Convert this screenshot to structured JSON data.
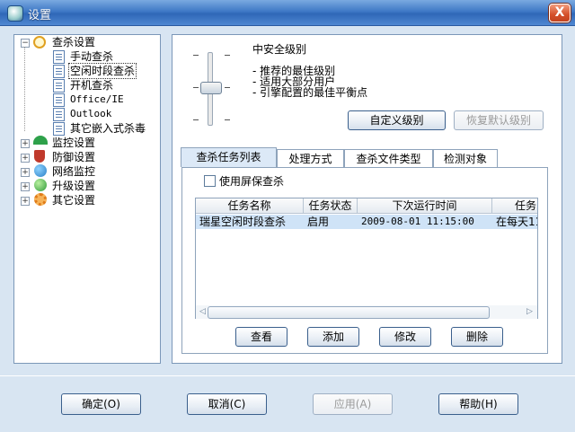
{
  "window": {
    "title": "设置",
    "close_label": "X"
  },
  "tree": {
    "items": [
      {
        "label": "查杀设置",
        "icon": "magnifier-icon",
        "expander": "-"
      },
      {
        "label": "手动查杀",
        "icon": "document-icon"
      },
      {
        "label": "空闲时段查杀",
        "icon": "document-icon",
        "selected": true
      },
      {
        "label": "开机查杀",
        "icon": "document-icon"
      },
      {
        "label": "Office/IE",
        "icon": "document-icon"
      },
      {
        "label": "Outlook",
        "icon": "document-icon"
      },
      {
        "label": "其它嵌入式杀毒",
        "icon": "document-icon"
      },
      {
        "label": "监控设置",
        "icon": "umbrella-icon",
        "expander": "+"
      },
      {
        "label": "防御设置",
        "icon": "shield-icon",
        "expander": "+"
      },
      {
        "label": "网络监控",
        "icon": "globe-icon",
        "expander": "+"
      },
      {
        "label": "升级设置",
        "icon": "globe-arrow-icon",
        "expander": "+"
      },
      {
        "label": "其它设置",
        "icon": "gear-icon",
        "expander": "+"
      }
    ]
  },
  "level": {
    "title": "中安全级别",
    "lines": [
      "- 推荐的最佳级别",
      "- 适用大部分用户",
      "- 引擎配置的最佳平衡点"
    ],
    "custom_button": "自定义级别",
    "restore_button": "恢复默认级别"
  },
  "tabs": [
    "查杀任务列表",
    "处理方式",
    "查杀文件类型",
    "检测对象"
  ],
  "screensaver_checkbox": "使用屏保查杀",
  "table": {
    "columns": [
      "任务名称",
      "任务状态",
      "下次运行时间",
      "任务"
    ],
    "rows": [
      [
        "瑞星空闲时段查杀",
        "启用",
        "2009-08-01 11:15:00",
        "在每天11"
      ]
    ]
  },
  "task_buttons": {
    "view": "查看",
    "add": "添加",
    "edit": "修改",
    "delete": "删除"
  },
  "footer_buttons": {
    "ok": "确定(O)",
    "cancel": "取消(C)",
    "apply": "应用(A)",
    "help": "帮助(H)"
  }
}
